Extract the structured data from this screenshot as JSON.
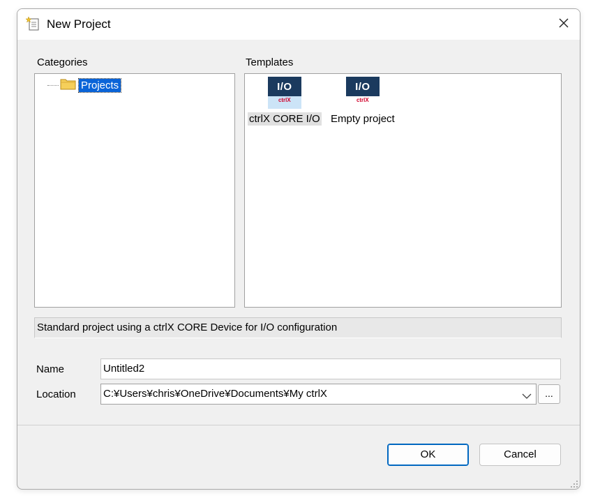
{
  "window": {
    "title": "New Project",
    "icon": "new-document-icon",
    "close_icon": "close-icon"
  },
  "categories": {
    "label": "Categories",
    "items": [
      {
        "label": "Projects",
        "icon": "folder-icon",
        "selected": true
      }
    ]
  },
  "templates": {
    "label": "Templates",
    "items": [
      {
        "label": "ctrlX CORE I/O",
        "icon_text": "I/O",
        "icon_brand": "ctrlX",
        "selected": true
      },
      {
        "label": "Empty project",
        "icon_text": "I/O",
        "icon_brand": "ctrlX",
        "selected": false
      }
    ]
  },
  "description": "Standard project using a ctrlX CORE Device for I/O configuration",
  "form": {
    "name_label": "Name",
    "name_value": "Untitled2",
    "location_label": "Location",
    "location_value": "C:¥Users¥chris¥OneDrive¥Documents¥My ctrlX",
    "browse_label": "..."
  },
  "buttons": {
    "ok": "OK",
    "cancel": "Cancel"
  },
  "colors": {
    "selection": "#0a64d8",
    "icon_bg": "#1b3a5e",
    "accent": "#0067c0",
    "brand_red": "#d1002a"
  }
}
